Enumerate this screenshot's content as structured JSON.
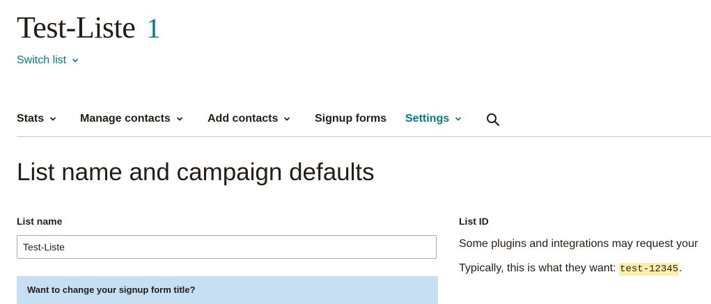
{
  "header": {
    "list_title": "Test-Liste",
    "list_count": "1",
    "switch_list_label": "Switch list"
  },
  "nav": {
    "items": [
      {
        "label": "Stats",
        "has_dropdown": true,
        "active": false
      },
      {
        "label": "Manage contacts",
        "has_dropdown": true,
        "active": false
      },
      {
        "label": "Add contacts",
        "has_dropdown": true,
        "active": false
      },
      {
        "label": "Signup forms",
        "has_dropdown": false,
        "active": false
      },
      {
        "label": "Settings",
        "has_dropdown": true,
        "active": true
      }
    ],
    "search_icon": "search-icon"
  },
  "main": {
    "section_title": "List name and campaign defaults",
    "list_name_label": "List name",
    "list_name_value": "Test-Liste",
    "info_box_text": "Want to change your signup form title?",
    "list_id_label": "List ID",
    "list_id_description": "Some plugins and integrations may request your",
    "list_id_typical_prefix": "Typically, this is what they want: ",
    "list_id_value": "test-12345",
    "list_id_typical_suffix": "."
  },
  "colors": {
    "accent": "#007c89",
    "text": "#241c15",
    "info_box_bg": "#c7dff3",
    "code_highlight": "#fbeea6",
    "divider": "#c7c7c7"
  }
}
